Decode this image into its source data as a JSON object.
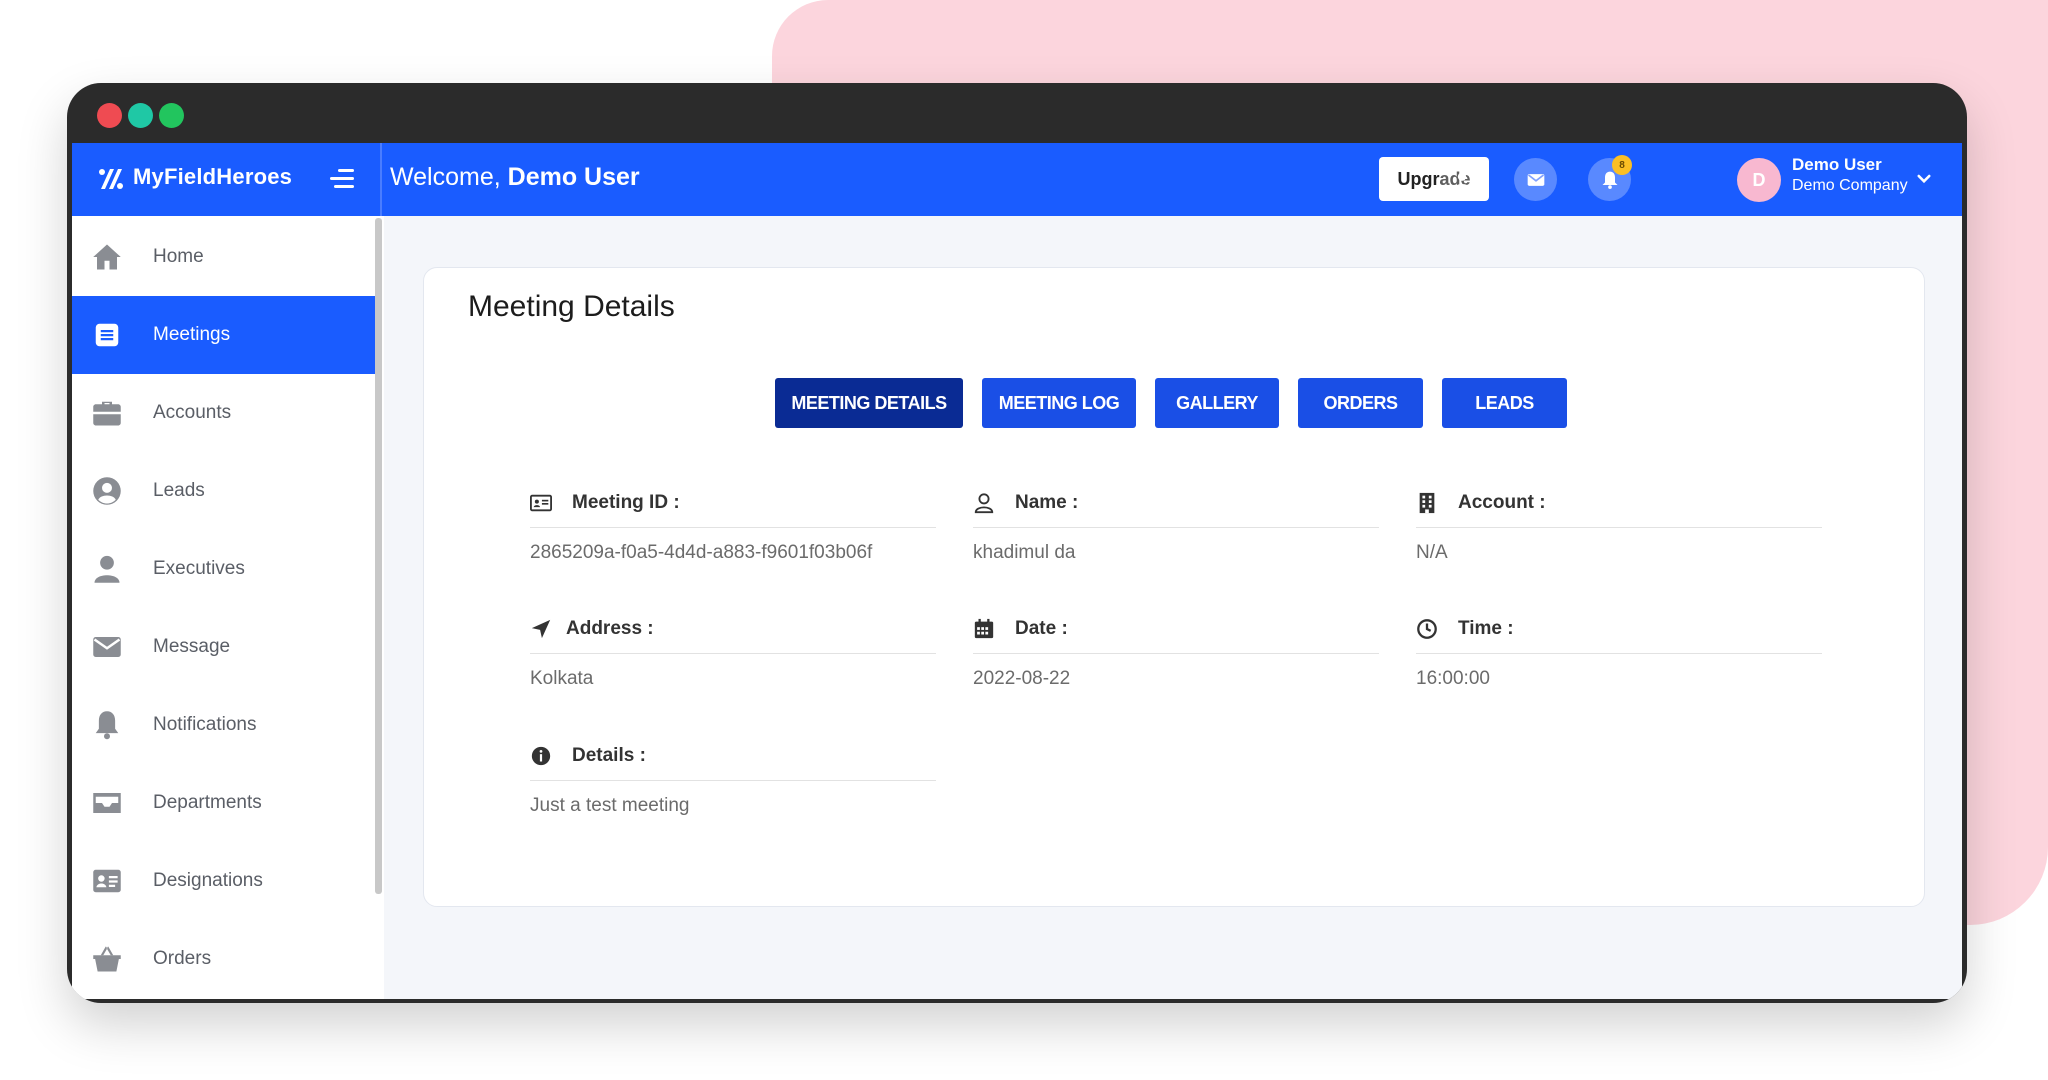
{
  "header": {
    "brand": "MyFieldHeroes",
    "welcome_prefix": "Welcome,",
    "welcome_user": "Demo User",
    "upgrade_label": "Upgrade",
    "notification_count": "8",
    "avatar_initial": "D",
    "user_name": "Demo User",
    "user_company": "Demo Company"
  },
  "sidebar": {
    "items": [
      {
        "label": "Home",
        "icon": "home-icon"
      },
      {
        "label": "Meetings",
        "icon": "meetings-icon",
        "active": true
      },
      {
        "label": "Accounts",
        "icon": "briefcase-icon"
      },
      {
        "label": "Leads",
        "icon": "user-circle-icon"
      },
      {
        "label": "Executives",
        "icon": "user-icon"
      },
      {
        "label": "Message",
        "icon": "envelope-icon"
      },
      {
        "label": "Notifications",
        "icon": "bell-icon"
      },
      {
        "label": "Departments",
        "icon": "inbox-icon"
      },
      {
        "label": "Designations",
        "icon": "id-card-icon"
      },
      {
        "label": "Orders",
        "icon": "basket-icon"
      }
    ]
  },
  "main": {
    "title": "Meeting Details",
    "tabs": [
      {
        "label": "MEETING DETAILS",
        "active": true
      },
      {
        "label": "MEETING LOG"
      },
      {
        "label": "GALLERY"
      },
      {
        "label": "ORDERS"
      },
      {
        "label": "LEADS"
      }
    ],
    "fields": {
      "meeting_id": {
        "label": "Meeting ID :",
        "value": "2865209a-f0a5-4d4d-a883-f9601f03b06f"
      },
      "name": {
        "label": "Name :",
        "value": "khadimul da"
      },
      "account": {
        "label": "Account :",
        "value": "N/A"
      },
      "address": {
        "label": "Address :",
        "value": "Kolkata"
      },
      "date": {
        "label": "Date :",
        "value": "2022-08-22"
      },
      "time": {
        "label": "Time :",
        "value": "16:00:00"
      },
      "details": {
        "label": "Details :",
        "value": "Just a test meeting"
      }
    }
  },
  "colors": {
    "primary": "#1a5cff",
    "tab": "#1a4fe6",
    "tab_active": "#0a2b94",
    "accent_bg": "#fcd5dd",
    "badge": "#fbbf24"
  }
}
